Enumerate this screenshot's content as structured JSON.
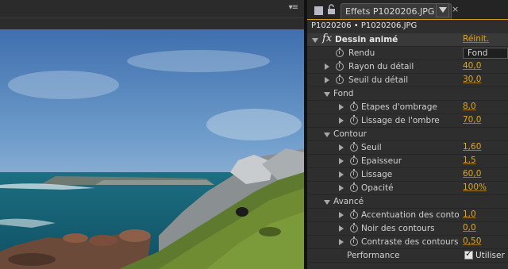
{
  "viewer": {
    "menu_icon": "panel-menu-icon",
    "image": "coastal landscape with cartoon effect"
  },
  "panel": {
    "tab_title": "Effets P1020206.JPG",
    "close_glyph": "×",
    "layer_path": "P1020206 • P1020206.JPG"
  },
  "effect": {
    "fx_label": "fx",
    "name": "Dessin animé",
    "reset_label": "Réinit."
  },
  "properties": {
    "rendu": {
      "label": "Rendu",
      "value": "Fond"
    },
    "rayon": {
      "label": "Rayon du détail",
      "value": "40,0"
    },
    "seuil_detail": {
      "label": "Seuil du détail",
      "value": "30,0"
    },
    "fond_group": {
      "label": "Fond"
    },
    "etapes": {
      "label": "Etapes d'ombrage",
      "value": "8,0"
    },
    "lissage_ombre": {
      "label": "Lissage de l'ombre",
      "value": "70,0"
    },
    "contour_group": {
      "label": "Contour"
    },
    "seuil": {
      "label": "Seuil",
      "value": "1,60"
    },
    "epaisseur": {
      "label": "Epaisseur",
      "value": "1,5"
    },
    "lissage": {
      "label": "Lissage",
      "value": "60,0"
    },
    "opacite": {
      "label": "Opacité",
      "value": "100%"
    },
    "avance_group": {
      "label": "Avancé"
    },
    "accentuation": {
      "label": "Accentuation des contou",
      "value": "1,0"
    },
    "noir": {
      "label": "Noir des contours",
      "value": "0,0"
    },
    "contraste": {
      "label": "Contraste des contours",
      "value": "0,50"
    },
    "performance": {
      "label": "Performance",
      "checkbox_label": "Utiliser",
      "checked": true
    }
  },
  "colors": {
    "accent": "#e2a526",
    "panel_bg": "#2e2e2e",
    "tab_underline": "#d89a1c"
  }
}
